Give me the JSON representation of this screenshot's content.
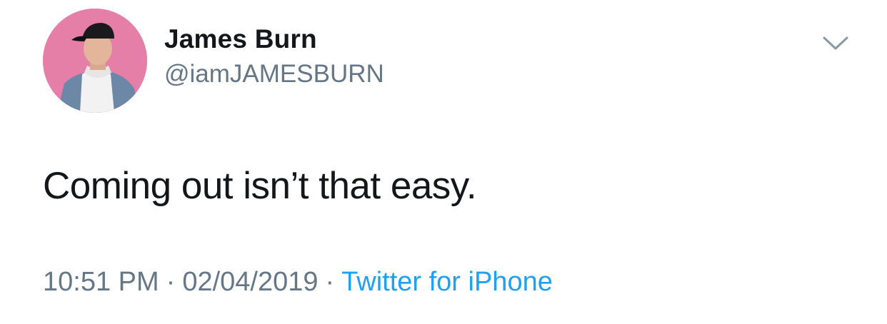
{
  "author": {
    "display_name": "James Burn",
    "handle": "@iamJAMESBURN",
    "avatar_icon": "profile-photo"
  },
  "tweet": {
    "text": "Coming out isn’t that easy."
  },
  "meta": {
    "time": "10:51 PM",
    "separator": "·",
    "date": "02/04/2019",
    "source": "Twitter for iPhone"
  },
  "menu": {
    "icon": "chevron-down-icon"
  },
  "colors": {
    "text_primary": "#14171a",
    "text_secondary": "#657786",
    "link": "#1da1f2",
    "avatar_bg": "#e57fa8"
  }
}
